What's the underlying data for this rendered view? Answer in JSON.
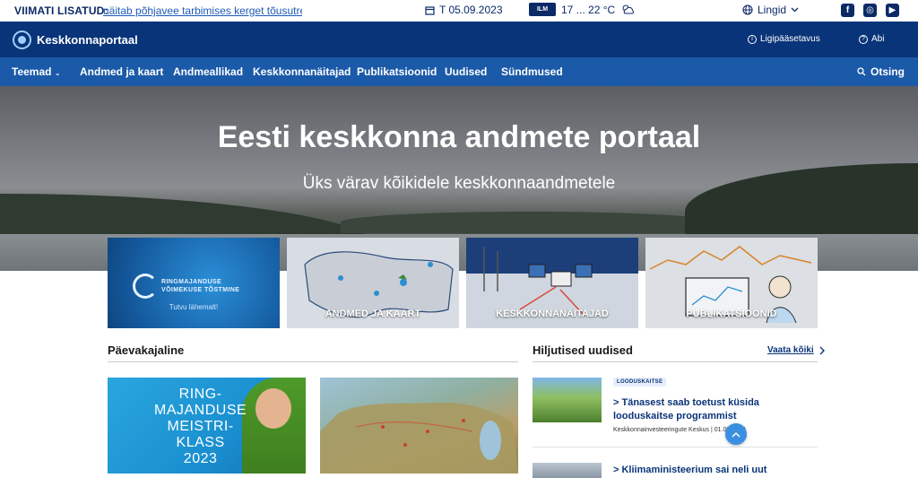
{
  "topbar": {
    "latest_label": "VIIMATI LISATUD:",
    "latest_link": "näitab põhjavee tarbimises kerget tõusutrend",
    "date": "T 05.09.2023",
    "weather_badge": "ILM",
    "temperature": "17 ... 22 °C",
    "language": "Lingid",
    "social": [
      "facebook-icon",
      "instagram-icon",
      "youtube-icon"
    ]
  },
  "header": {
    "logo_text": "Keskkonnaportaal",
    "accessibility": "Ligipääsetavus",
    "help": "Abi"
  },
  "nav": {
    "items": [
      "Teemad",
      "Andmed ja kaart",
      "Andmeallikad",
      "Keskkonnanäitajad",
      "Publikatsioonid",
      "Uudised",
      "Sündmused"
    ],
    "search": "Otsing"
  },
  "hero": {
    "title": "Eesti keskkonna andmete portaal",
    "subtitle": "Üks värav kõikidele keskkonnaandmetele"
  },
  "cards": {
    "promo_line1": "RINGMAJANDUSE",
    "promo_line2": "VÕIMEKUSE TÕSTMINE",
    "promo_more": "Tutvu lähemalt!",
    "labels": [
      "ANDMED JA KAART",
      "KESKKONNANÄITAJAD",
      "PUBLIKATSIOONID"
    ]
  },
  "daily": {
    "title": "Päevakajaline",
    "promo_text_line1": "RING-",
    "promo_text_line2": "MAJANDUSE",
    "promo_text_line3": "MEISTRI-",
    "promo_text_line4": "KLASS",
    "promo_text_line5": "2023"
  },
  "news": {
    "title": "Hiljutised uudised",
    "see_all": "Vaata kõiki",
    "items": [
      {
        "tag": "LOODUSKAITSE",
        "title": "> Tänasest saab toetust küsida looduskaitse programmist",
        "meta": "Keskkonnainvesteeringute Keskus  |  01.09.2023"
      },
      {
        "title": "> Kliimaministeerium sai neli uut"
      }
    ]
  },
  "colors": {
    "header": "#0a3479",
    "nav": "#1b5aa8",
    "accent": "#3a8fe0"
  }
}
